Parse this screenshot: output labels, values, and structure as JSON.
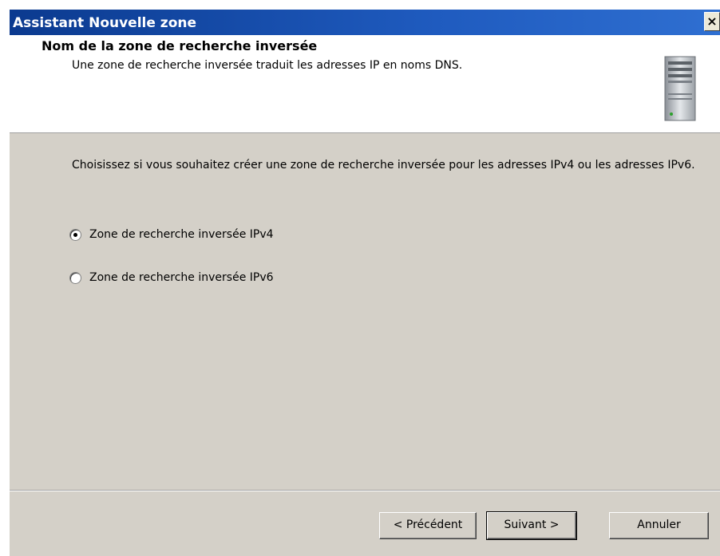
{
  "window": {
    "title": "Assistant Nouvelle zone",
    "close_label": "×"
  },
  "header": {
    "title": "Nom de la zone de recherche inversée",
    "subtitle": "Une zone de recherche inversée traduit les adresses IP en noms DNS.",
    "icon": "server-icon"
  },
  "content": {
    "intro": "Choisissez si vous souhaitez créer une zone de recherche inversée pour les adresses IPv4 ou les adresses IPv6.",
    "options": [
      {
        "label": "Zone de recherche inversée IPv4",
        "checked": true
      },
      {
        "label": "Zone de recherche inversée IPv6",
        "checked": false
      }
    ]
  },
  "buttons": {
    "back": "< Précédent",
    "next": "Suivant >",
    "cancel": "Annuler"
  },
  "colors": {
    "titlebar": "#0b3a8f",
    "dialog_bg": "#d4d0c8",
    "header_bg": "#ffffff"
  }
}
